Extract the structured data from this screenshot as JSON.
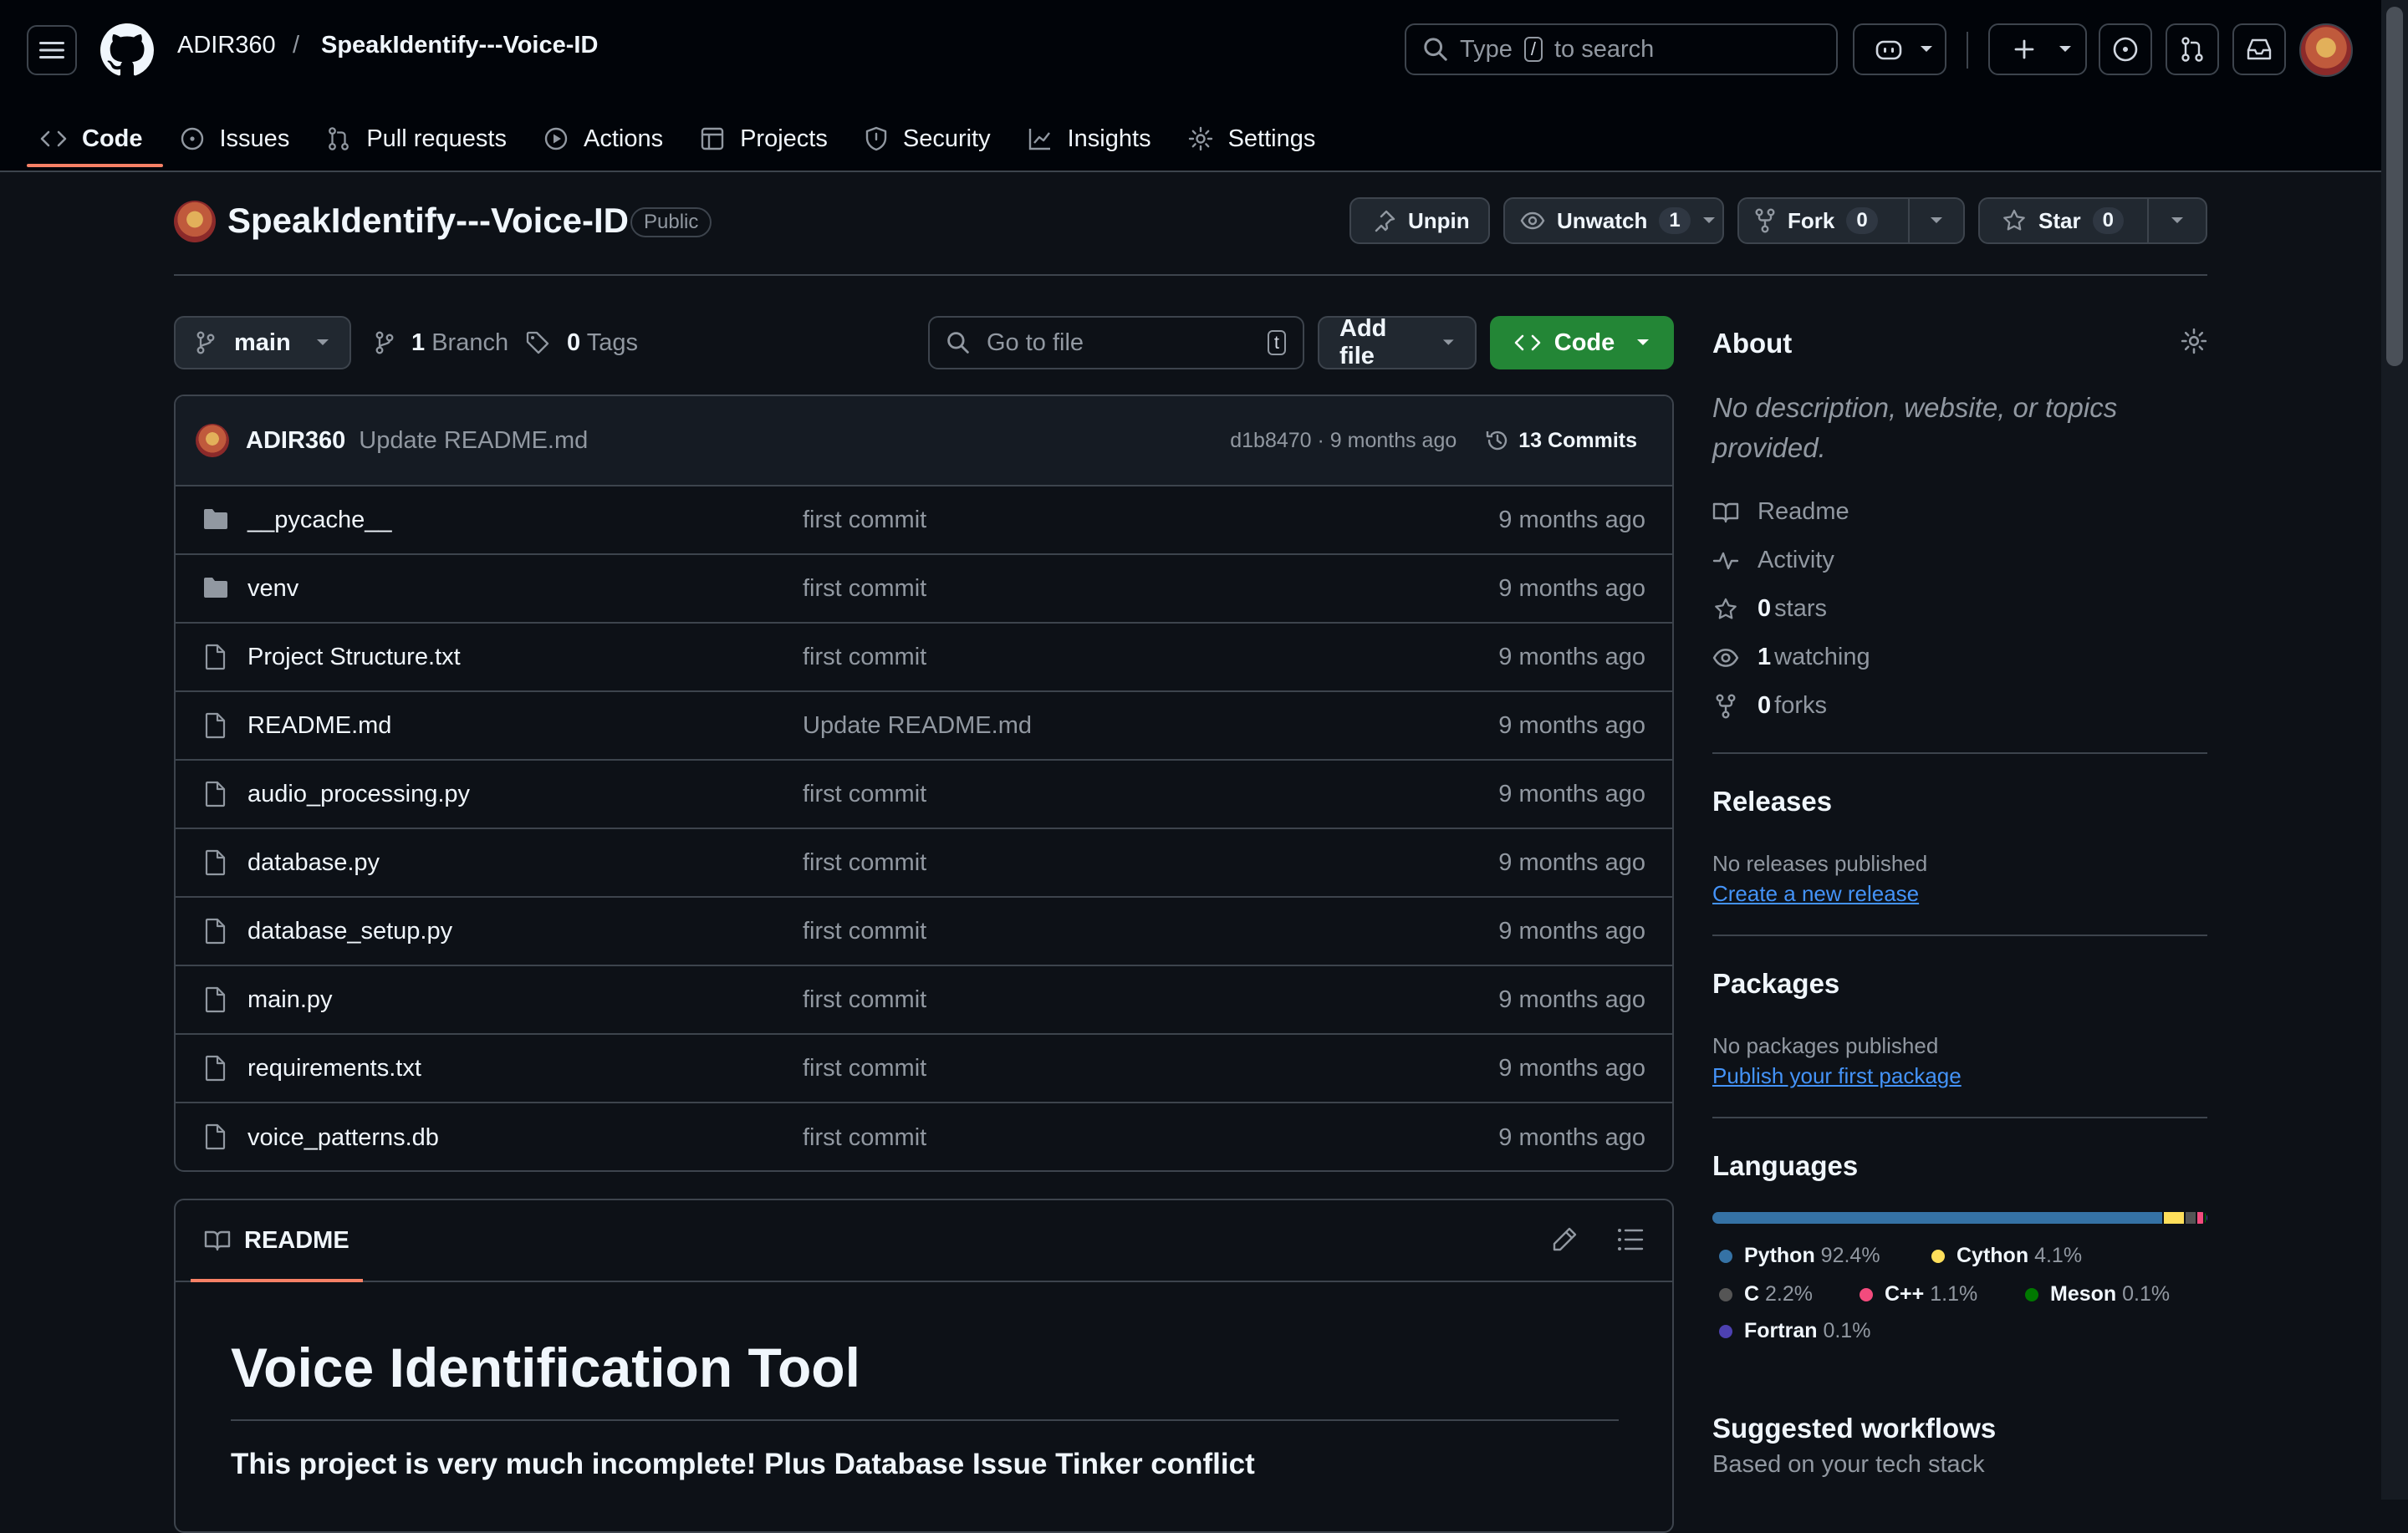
{
  "header": {
    "owner": "ADIR360",
    "separator": "/",
    "repo": "SpeakIdentify---Voice-ID",
    "search": {
      "prefix": "Type",
      "key": "/",
      "suffix": "to search"
    }
  },
  "tabs": [
    {
      "label": "Code",
      "icon": "code-icon"
    },
    {
      "label": "Issues",
      "icon": "issue-icon"
    },
    {
      "label": "Pull requests",
      "icon": "pull-request-icon"
    },
    {
      "label": "Actions",
      "icon": "play-icon"
    },
    {
      "label": "Projects",
      "icon": "table-icon"
    },
    {
      "label": "Security",
      "icon": "shield-icon"
    },
    {
      "label": "Insights",
      "icon": "graph-icon"
    },
    {
      "label": "Settings",
      "icon": "gear-icon"
    }
  ],
  "repo_header": {
    "title": "SpeakIdentify---Voice-ID",
    "visibility": "Public",
    "unpin": "Unpin",
    "unwatch": "Unwatch",
    "watch_count": "1",
    "fork": "Fork",
    "fork_count": "0",
    "star": "Star",
    "star_count": "0"
  },
  "controls": {
    "branch": "main",
    "branch_count": "1",
    "branch_label": "Branch",
    "tag_count": "0",
    "tag_label": "Tags",
    "goto_placeholder": "Go to file",
    "goto_key": "t",
    "add_file": "Add file",
    "code": "Code"
  },
  "latest_commit": {
    "author": "ADIR360",
    "message": "Update README.md",
    "hash": "d1b8470 · 9 months ago",
    "commits": "13 Commits"
  },
  "files": [
    {
      "name": "__pycache__",
      "type": "dir",
      "message": "first commit",
      "age": "9 months ago"
    },
    {
      "name": "venv",
      "type": "dir",
      "message": "first commit",
      "age": "9 months ago"
    },
    {
      "name": "Project Structure.txt",
      "type": "file",
      "message": "first commit",
      "age": "9 months ago"
    },
    {
      "name": "README.md",
      "type": "file",
      "message": "Update README.md",
      "age": "9 months ago"
    },
    {
      "name": "audio_processing.py",
      "type": "file",
      "message": "first commit",
      "age": "9 months ago"
    },
    {
      "name": "database.py",
      "type": "file",
      "message": "first commit",
      "age": "9 months ago"
    },
    {
      "name": "database_setup.py",
      "type": "file",
      "message": "first commit",
      "age": "9 months ago"
    },
    {
      "name": "main.py",
      "type": "file",
      "message": "first commit",
      "age": "9 months ago"
    },
    {
      "name": "requirements.txt",
      "type": "file",
      "message": "first commit",
      "age": "9 months ago"
    },
    {
      "name": "voice_patterns.db",
      "type": "file",
      "message": "first commit",
      "age": "9 months ago"
    }
  ],
  "readme": {
    "tab": "README",
    "heading": "Voice Identification Tool",
    "lead": "This project is very much incomplete! Plus Database Issue Tinker conflict"
  },
  "sidebar": {
    "about_title": "About",
    "about_desc": "No description, website, or topics provided.",
    "readme": "Readme",
    "activity": "Activity",
    "stars_count": "0",
    "stars_label": "stars",
    "watching_count": "1",
    "watching_label": "watching",
    "forks_count": "0",
    "forks_label": "forks",
    "releases_title": "Releases",
    "releases_text": "No releases published",
    "releases_link": "Create a new release",
    "packages_title": "Packages",
    "packages_text": "No packages published",
    "packages_link": "Publish your first package",
    "languages_title": "Languages",
    "languages": [
      {
        "name": "Python",
        "percent": "92.4%",
        "value": 92.4,
        "color": "#3572A5"
      },
      {
        "name": "Cython",
        "percent": "4.1%",
        "value": 4.1,
        "color": "#fedf5b"
      },
      {
        "name": "C",
        "percent": "2.2%",
        "value": 2.2,
        "color": "#555555"
      },
      {
        "name": "C++",
        "percent": "1.1%",
        "value": 1.1,
        "color": "#f34b7d"
      },
      {
        "name": "Meson",
        "percent": "0.1%",
        "value": 0.1,
        "color": "#007800"
      },
      {
        "name": "Fortran",
        "percent": "0.1%",
        "value": 0.1,
        "color": "#4d41b1"
      }
    ],
    "workflows_title": "Suggested workflows",
    "workflows_sub": "Based on your tech stack"
  },
  "colors": {
    "accent_tab": "#f78166",
    "primary_button": "#238636",
    "link": "#4493f8"
  }
}
